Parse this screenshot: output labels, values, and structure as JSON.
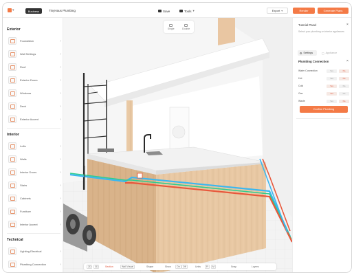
{
  "topbar": {
    "workspace_badge": "Business",
    "project_name": "TinyHaus Plumbing",
    "save_label": "Save",
    "tools_label": "Tools",
    "tools_chevron": "▾",
    "export_label": "Export",
    "export_chevron": "▾",
    "render_label": "Render",
    "generate_label": "Generate Plans",
    "accent_color": "#f47a46"
  },
  "view_pill": {
    "single_label": "Single",
    "double_label": "Double"
  },
  "sidebar": {
    "sections": [
      {
        "title": "Exterior",
        "items": [
          "Foundation",
          "Wall Settings",
          "Roof",
          "Exterior Doors",
          "Windows",
          "Deck",
          "Exterior Accent"
        ]
      },
      {
        "title": "Interior",
        "items": [
          "Lofts",
          "Walls",
          "Interior Doors",
          "Stairs",
          "Cabinets",
          "Furniture",
          "Interior Accent"
        ]
      },
      {
        "title": "Technical",
        "items": [
          "Lighting Electrical",
          "Plumbing Connection"
        ]
      }
    ],
    "arrow": "›"
  },
  "bottom_bar": {
    "items": [
      "2D",
      "3D",
      "Section",
      "Wall Visual",
      "Shape",
      "Show",
      "On",
      "Off",
      "Units",
      "Ft",
      "M",
      "Snap",
      "Layers"
    ]
  },
  "right_panel": {
    "title": "Tutorial Panel",
    "close": "×",
    "hint": "Select your plumbing on interior appliances",
    "tab_settings": "Settings",
    "tab_other": "Appliance",
    "section_title": "Plumbing Connection",
    "section_close": "×",
    "rows": [
      {
        "name": "Water Connection",
        "yes": "Yes",
        "no": "No",
        "selected": "no"
      },
      {
        "name": "Hot",
        "yes": "Yes",
        "no": "No",
        "selected": "no"
      },
      {
        "name": "Cold",
        "yes": "Yes",
        "no": "No",
        "selected": "yes"
      },
      {
        "name": "Gas",
        "yes": "Yes",
        "no": "No",
        "selected": "yes"
      },
      {
        "name": "Waste",
        "yes": "Yes",
        "no": "No",
        "selected": "no"
      }
    ],
    "confirm_label": "Confirm Plumbing"
  }
}
